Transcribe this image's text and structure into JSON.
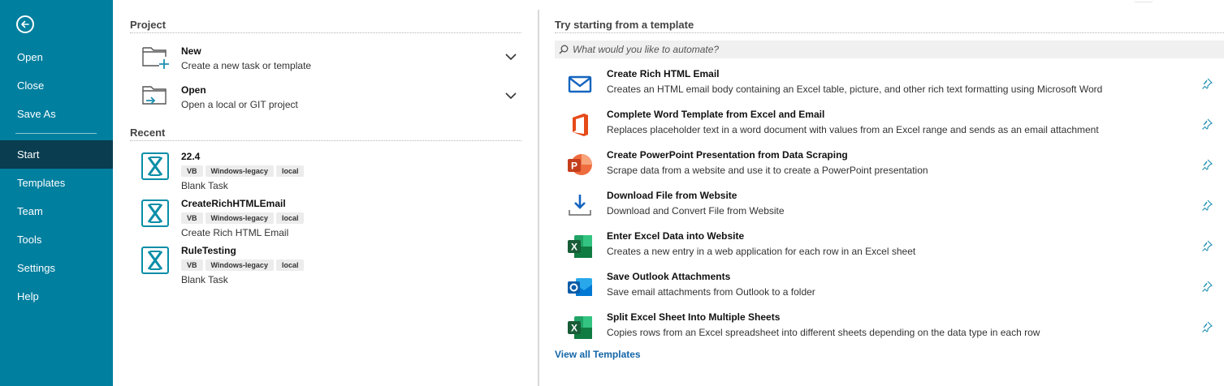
{
  "sidebar": {
    "back_icon": "arrow-left-circle-icon",
    "items": [
      {
        "label": "Open"
      },
      {
        "label": "Close"
      },
      {
        "label": "Save As"
      },
      {
        "label": "Start",
        "active": true
      },
      {
        "label": "Templates"
      },
      {
        "label": "Team"
      },
      {
        "label": "Tools"
      },
      {
        "label": "Settings"
      },
      {
        "label": "Help"
      }
    ],
    "bg_color": "#007f9f",
    "active_color": "#0a3d50"
  },
  "project": {
    "title": "Project",
    "items": [
      {
        "title": "New",
        "subtitle": "Create a new task or template",
        "icon": "new-folder-icon"
      },
      {
        "title": "Open",
        "subtitle": "Open a local or GIT project",
        "icon": "open-folder-icon"
      }
    ]
  },
  "recent": {
    "title": "Recent",
    "items": [
      {
        "name": "22.4",
        "tags": [
          "VB",
          "Windows-legacy",
          "local"
        ],
        "description": "Blank Task"
      },
      {
        "name": "CreateRichHTMLEmail",
        "tags": [
          "VB",
          "Windows-legacy",
          "local"
        ],
        "description": "Create Rich HTML Email"
      },
      {
        "name": "RuleTesting",
        "tags": [
          "VB",
          "Windows-legacy",
          "local"
        ],
        "description": "Blank Task"
      }
    ]
  },
  "templates": {
    "title": "Try starting from a template",
    "search_placeholder": "What would you like to automate?",
    "items": [
      {
        "title": "Create Rich HTML Email",
        "description": "Creates an HTML email body containing an Excel table, picture, and other rich text formatting using Microsoft Word",
        "icon": "mail-icon"
      },
      {
        "title": "Complete Word Template from Excel and Email",
        "description": "Replaces placeholder text in a word document with values from an Excel range and sends as an email attachment",
        "icon": "office-icon"
      },
      {
        "title": "Create PowerPoint Presentation from Data Scraping",
        "description": "Scrape data from a website and use it to create a PowerPoint presentation",
        "icon": "powerpoint-icon"
      },
      {
        "title": "Download File from Website",
        "description": "Download and Convert File from Website",
        "icon": "download-icon"
      },
      {
        "title": "Enter Excel Data into Website",
        "description": "Creates a new entry in a web application for each row in an Excel sheet",
        "icon": "excel-icon"
      },
      {
        "title": "Save Outlook Attachments",
        "description": "Save email attachments from Outlook to a folder",
        "icon": "outlook-icon"
      },
      {
        "title": "Split Excel Sheet Into Multiple Sheets",
        "description": "Copies rows from an Excel spreadsheet into different sheets depending on the data type in each row",
        "icon": "excel-icon"
      }
    ],
    "view_all_label": "View all Templates",
    "link_color": "#1366a8"
  }
}
